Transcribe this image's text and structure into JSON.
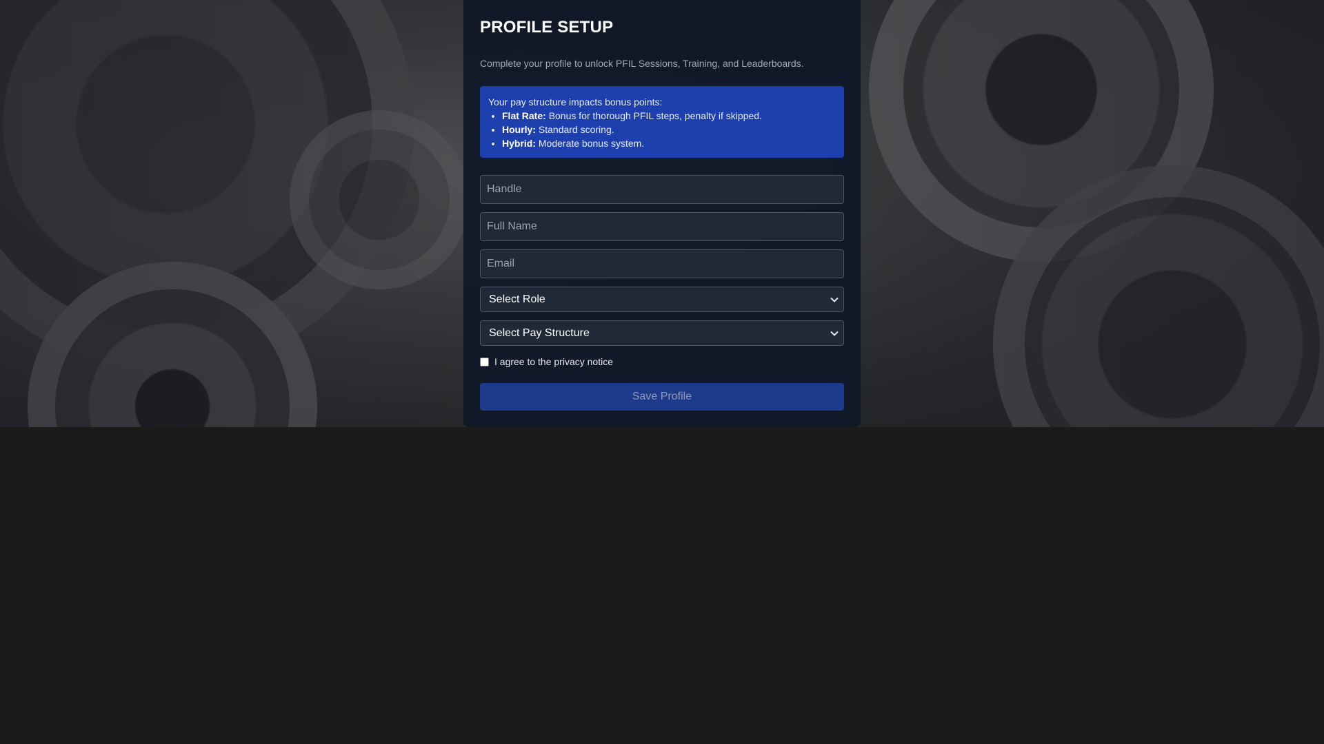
{
  "card": {
    "title": "PROFILE SETUP",
    "subtitle": "Complete your profile to unlock PFIL Sessions, Training, and Leaderboards."
  },
  "info": {
    "intro": "Your pay structure impacts bonus points:",
    "items": [
      {
        "label": "Flat Rate:",
        "text": "Bonus for thorough PFIL steps, penalty if skipped."
      },
      {
        "label": "Hourly:",
        "text": "Standard scoring."
      },
      {
        "label": "Hybrid:",
        "text": "Moderate bonus system."
      }
    ]
  },
  "form": {
    "handle_placeholder": "Handle",
    "fullname_placeholder": "Full Name",
    "email_placeholder": "Email",
    "role_select": "Select Role",
    "pay_select": "Select Pay Structure",
    "agree_label": "I agree to the privacy notice",
    "agree_checked": false,
    "save_label": "Save Profile",
    "save_disabled": true
  },
  "colors": {
    "card_bg": "#111827",
    "info_bg": "#1e40af",
    "button_bg": "#1e3a8a",
    "page_bg": "#1b1b1b"
  },
  "icons": {
    "select_arrow": "chevron-down-icon"
  }
}
